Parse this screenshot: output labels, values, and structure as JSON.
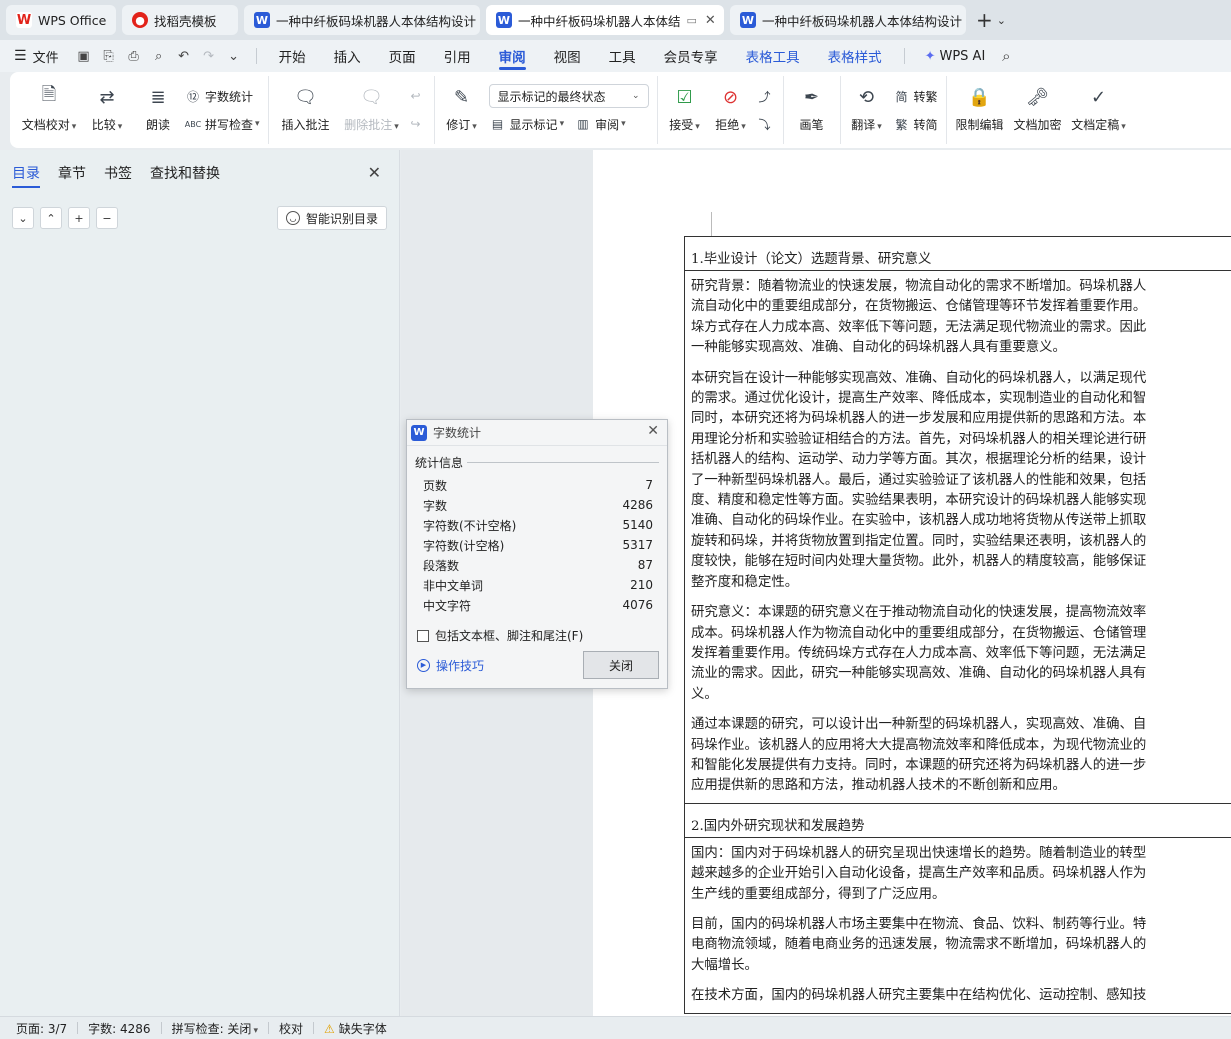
{
  "tabs": [
    {
      "label": "WPS Office",
      "icon": "wps-logo-icon",
      "active": false
    },
    {
      "label": "找稻壳模板",
      "icon": "docer-icon",
      "active": false
    },
    {
      "label": "一种中纤板码垛机器人本体结构设计",
      "icon": "writer-doc-icon",
      "active": false
    },
    {
      "label": "一种中纤板码垛机器人本体结",
      "icon": "writer-doc-icon",
      "active": true
    },
    {
      "label": "一种中纤板码垛机器人本体结构设计",
      "icon": "writer-doc-icon",
      "active": false
    }
  ],
  "menubar": {
    "file_label": "文件",
    "items": [
      "开始",
      "插入",
      "页面",
      "引用",
      "审阅",
      "视图",
      "工具",
      "会员专享"
    ],
    "active_item": "审阅",
    "context_items": [
      "表格工具",
      "表格样式"
    ],
    "wps_ai_label": "WPS AI"
  },
  "ribbon": {
    "doc_check": "文档校对",
    "compare": "比较",
    "read_aloud": "朗读",
    "word_count": "字数统计",
    "spell_check": "拼写检查",
    "insert_comment": "插入批注",
    "delete_comment": "删除批注",
    "track_changes": "修订",
    "markup_state": "显示标记的最终状态",
    "show_markup": "显示标记",
    "review_pane": "审阅",
    "accept": "接受",
    "reject": "拒绝",
    "pen": "画笔",
    "translate": "翻译",
    "to_traditional": "转繁",
    "to_simplified": "转简",
    "restrict_edit": "限制编辑",
    "encrypt": "文档加密",
    "finalize": "文档定稿"
  },
  "navpanel": {
    "tabs": [
      "目录",
      "章节",
      "书签",
      "查找和替换"
    ],
    "active_tab": "目录",
    "smart_toc_label": "智能识别目录"
  },
  "document": {
    "section1_title": "1.毕业设计（论文）选题背景、研究意义",
    "section1_paragraphs": [
      [
        "研究背景：随着物流业的快速发展，物流自动化的需求不断增加。码垛机器人",
        "流自动化中的重要组成部分，在货物搬运、仓储管理等环节发挥着重要作用。",
        "垛方式存在人力成本高、效率低下等问题，无法满足现代物流业的需求。因此",
        "一种能够实现高效、准确、自动化的码垛机器人具有重要意义。"
      ],
      [
        "本研究旨在设计一种能够实现高效、准确、自动化的码垛机器人，以满足现代",
        "的需求。通过优化设计，提高生产效率、降低成本，实现制造业的自动化和智",
        "同时，本研究还将为码垛机器人的进一步发展和应用提供新的思路和方法。本",
        "用理论分析和实验验证相结合的方法。首先，对码垛机器人的相关理论进行研",
        "括机器人的结构、运动学、动力学等方面。其次，根据理论分析的结果，设计",
        "了一种新型码垛机器人。最后，通过实验验证了该机器人的性能和效果，包括",
        "度、精度和稳定性等方面。实验结果表明，本研究设计的码垛机器人能够实现",
        "准确、自动化的码垛作业。在实验中，该机器人成功地将货物从传送带上抓取",
        "旋转和码垛，并将货物放置到指定位置。同时，实验结果还表明，该机器人的",
        "度较快，能够在短时间内处理大量货物。此外，机器人的精度较高，能够保证",
        "整齐度和稳定性。"
      ],
      [
        "研究意义：本课题的研究意义在于推动物流自动化的快速发展，提高物流效率",
        "成本。码垛机器人作为物流自动化中的重要组成部分，在货物搬运、仓储管理",
        "发挥着重要作用。传统码垛方式存在人力成本高、效率低下等问题，无法满足",
        "流业的需求。因此，研究一种能够实现高效、准确、自动化的码垛机器人具有",
        "义。"
      ],
      [
        "通过本课题的研究，可以设计出一种新型的码垛机器人，实现高效、准确、自",
        "码垛作业。该机器人的应用将大大提高物流效率和降低成本，为现代物流业的",
        "和智能化发展提供有力支持。同时，本课题的研究还将为码垛机器人的进一步",
        "应用提供新的思路和方法，推动机器人技术的不断创新和应用。"
      ]
    ],
    "section2_title": "2.国内外研究现状和发展趋势",
    "section2_paragraphs": [
      [
        "国内：国内对于码垛机器人的研究呈现出快速增长的趋势。随着制造业的转型",
        "越来越多的企业开始引入自动化设备，提高生产效率和品质。码垛机器人作为",
        "生产线的重要组成部分，得到了广泛应用。"
      ],
      [
        "目前，国内的码垛机器人市场主要集中在物流、食品、饮料、制药等行业。特",
        "电商物流领域，随着电商业务的迅速发展，物流需求不断增加，码垛机器人的",
        "大幅增长。"
      ],
      [
        "在技术方面，国内的码垛机器人研究主要集中在结构优化、运动控制、感知技"
      ]
    ]
  },
  "dialog": {
    "title": "字数统计",
    "section_label": "统计信息",
    "stats": [
      {
        "label": "页数",
        "value": "7"
      },
      {
        "label": "字数",
        "value": "4286"
      },
      {
        "label": "字符数(不计空格)",
        "value": "5140"
      },
      {
        "label": "字符数(计空格)",
        "value": "5317"
      },
      {
        "label": "段落数",
        "value": "87"
      },
      {
        "label": "非中文单词",
        "value": "210"
      },
      {
        "label": "中文字符",
        "value": "4076"
      }
    ],
    "include_label": "包括文本框、脚注和尾注(F)",
    "tips_label": "操作技巧",
    "close_label": "关闭"
  },
  "statusbar": {
    "page": "页面: 3/7",
    "words": "字数: 4286",
    "spell": "拼写检查: 关闭",
    "proof": "校对",
    "missing_font": "缺失字体"
  },
  "colors": {
    "accent": "#2b5bd7",
    "wps_red": "#e2231a",
    "writer_blue": "#2b5bd7"
  }
}
